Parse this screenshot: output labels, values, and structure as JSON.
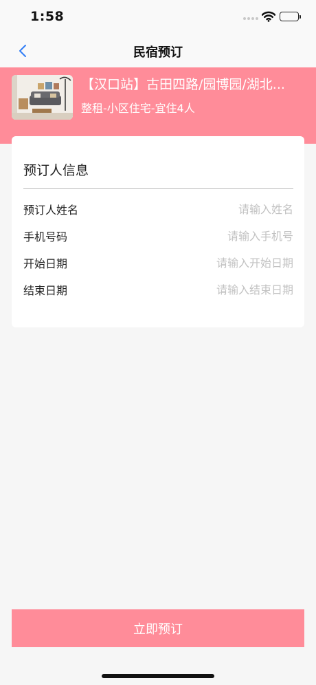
{
  "status_bar": {
    "time": "1:58"
  },
  "nav": {
    "title": "民宿预订",
    "back_icon": "chevron-left-icon"
  },
  "listing": {
    "title": "【汉口站】古田四路/园博园/湖北...",
    "subtitle": "整租-小区住宅-宜住4人"
  },
  "form": {
    "heading": "预订人信息",
    "fields": [
      {
        "label": "预订人姓名",
        "value": "",
        "placeholder": "请输入姓名"
      },
      {
        "label": "手机号码",
        "value": "",
        "placeholder": "请输入手机号"
      },
      {
        "label": "开始日期",
        "value": "",
        "placeholder": "请输入开始日期"
      },
      {
        "label": "结束日期",
        "value": "",
        "placeholder": "请输入结束日期"
      }
    ]
  },
  "footer": {
    "book_label": "立即预订"
  },
  "colors": {
    "accent": "#ff8c99",
    "back_icon": "#2f7cf6",
    "background": "#f6f6f6"
  }
}
